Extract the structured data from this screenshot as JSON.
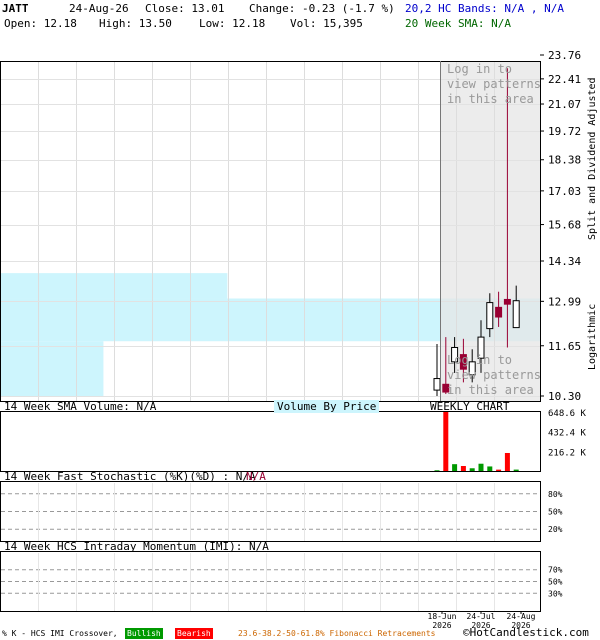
{
  "header": {
    "symbol": "JATT",
    "date": "24-Aug-26",
    "close_label": "Close: 13.01",
    "change_label": "Change: -0.23 (-1.7 %)",
    "bands_label": "20,2 HC Bands: N/A , N/A",
    "open_label": "Open: 12.18",
    "high_label": "High: 13.50",
    "low_label": "Low: 12.18",
    "vol_label": "Vol: 15,395",
    "sma_label": "20 Week SMA: N/A"
  },
  "overlay": {
    "login_top": "Log in to\nview patterns\nin this area",
    "login_bottom": "Log in to\nview patterns\nin this area"
  },
  "side_labels": {
    "right_top": "Split and Dividend Adjusted",
    "right_bottom": "Logarithmic"
  },
  "volume_panel": {
    "title": "14 Week SMA Volume: N/A",
    "vbp_label": "Volume By Price",
    "weekly_label": "WEEKLY CHART",
    "ticks": [
      "648.6 K",
      "432.4 K",
      "216.2 K"
    ]
  },
  "stoch_panel": {
    "title": "14 Week Fast Stochastic (%K)(%D) : N/A",
    "na": "N/A",
    "ticks": [
      "80%",
      "50%",
      "20%"
    ]
  },
  "imi_panel": {
    "title": "14 Week HCS Intraday Momentum (IMI): N/A",
    "ticks": [
      "70%",
      "50%",
      "30%"
    ]
  },
  "x_axis": [
    {
      "d": "18-Jun",
      "y": "2026"
    },
    {
      "d": "24-Jul",
      "y": "2026"
    },
    {
      "d": "24-Aug",
      "y": "2026"
    }
  ],
  "footer": {
    "crossover": "% K - HCS IMI Crossover,",
    "bullish": "Bullish",
    "bearish": "Bearish",
    "fib": "23.6-38.2-50-61.8% Fibonacci Retracements",
    "copyright": "©HotCandlestick.com"
  },
  "colors": {
    "up": "#ffffff",
    "down": "#990033",
    "vbp": "#cdf5fd",
    "volume_up": "#009900",
    "volume_down": "#ff0000",
    "bands": "#0000cc",
    "sma": "#006600"
  },
  "chart_data": {
    "type": "candlestick",
    "y_scale": "log",
    "y_ticks": [
      23.76,
      22.41,
      21.07,
      19.72,
      18.38,
      17.03,
      15.68,
      14.34,
      12.99,
      11.65,
      10.3
    ],
    "ylim": [
      10.3,
      23.76
    ],
    "candles": [
      {
        "o": 10.45,
        "h": 11.7,
        "l": 10.3,
        "c": 10.75,
        "v": 8000
      },
      {
        "o": 10.6,
        "h": 11.9,
        "l": 10.35,
        "c": 10.4,
        "v": 648600
      },
      {
        "o": 11.2,
        "h": 11.9,
        "l": 10.9,
        "c": 11.6,
        "v": 75000
      },
      {
        "o": 11.4,
        "h": 11.85,
        "l": 10.65,
        "c": 11.0,
        "v": 55000
      },
      {
        "o": 10.85,
        "h": 11.55,
        "l": 10.65,
        "c": 11.2,
        "v": 30000
      },
      {
        "o": 11.3,
        "h": 12.4,
        "l": 10.9,
        "c": 11.9,
        "v": 80000
      },
      {
        "o": 12.15,
        "h": 13.25,
        "l": 11.9,
        "c": 12.95,
        "v": 50000
      },
      {
        "o": 12.8,
        "h": 13.3,
        "l": 12.2,
        "c": 12.5,
        "v": 15000
      },
      {
        "o": 13.05,
        "h": 23.0,
        "l": 11.6,
        "c": 12.9,
        "v": 198000
      },
      {
        "o": 12.18,
        "h": 13.5,
        "l": 12.18,
        "c": 13.01,
        "v": 15395
      }
    ],
    "vbp_bands": [
      {
        "lo": 13.08,
        "hi": 13.92,
        "vol": 0.42
      },
      {
        "lo": 11.78,
        "hi": 13.08,
        "vol": 1.0
      },
      {
        "lo": 10.3,
        "hi": 11.78,
        "vol": 0.19
      }
    ]
  }
}
